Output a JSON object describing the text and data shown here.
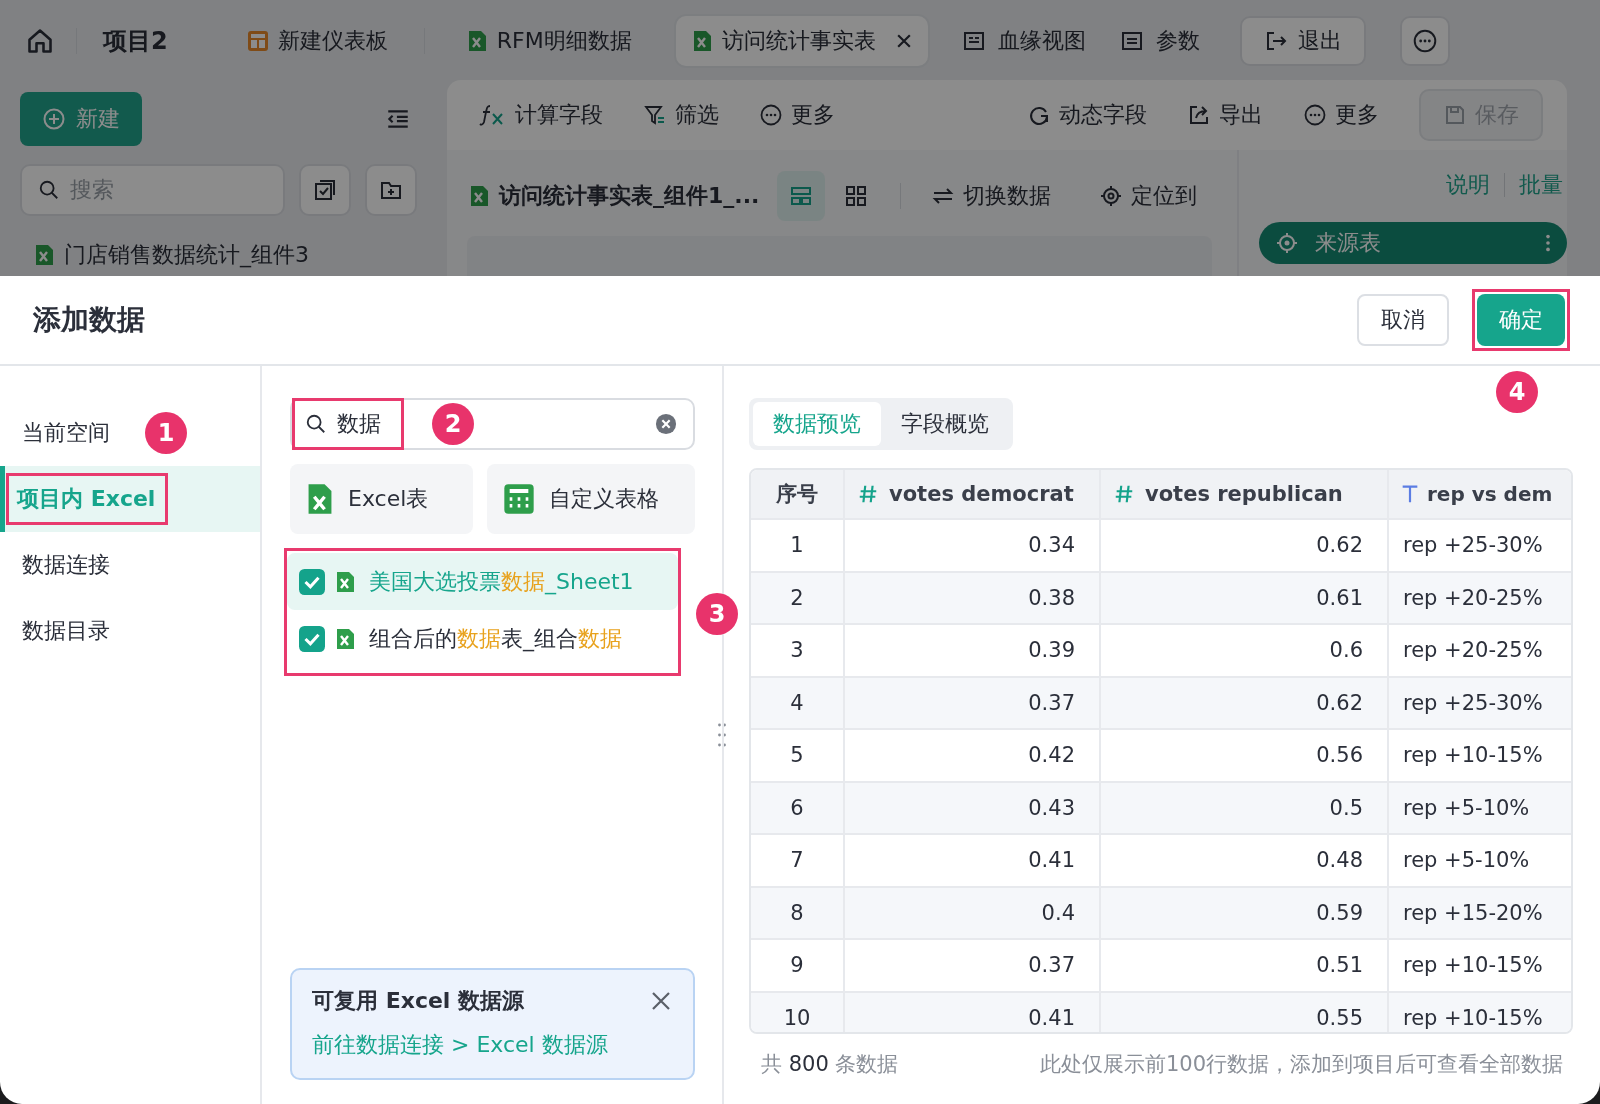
{
  "app": {
    "project": "项目2",
    "tabs": [
      {
        "label": "新建仪表板",
        "kind": "dashboard",
        "selected": false,
        "closable": false
      },
      {
        "label": "RFM明细数据",
        "kind": "excel",
        "selected": false,
        "closable": false
      },
      {
        "label": "访问统计事实表",
        "kind": "excel",
        "selected": true,
        "closable": true
      }
    ],
    "nav_links": [
      {
        "label": "血缘视图",
        "kind": "lineage"
      },
      {
        "label": "参数",
        "kind": "params"
      }
    ],
    "exit_button": "退出",
    "sidebar": {
      "new_button": "新建",
      "search_placeholder": "搜索",
      "tree": [
        {
          "label": "门店销售数据统计_组件3"
        }
      ]
    },
    "toolbar": {
      "left": [
        {
          "label": "计算字段",
          "kind": "fx"
        },
        {
          "label": "筛选",
          "kind": "filter"
        },
        {
          "label": "更多",
          "kind": "more"
        }
      ],
      "right": [
        {
          "label": "动态字段",
          "kind": "dynamic"
        },
        {
          "label": "导出",
          "kind": "export"
        },
        {
          "label": "更多",
          "kind": "more"
        }
      ],
      "save": {
        "label": "保存",
        "disabled": true
      }
    },
    "dataset": {
      "name": "访问统计事实表_组件1_...",
      "views": [
        {
          "kind": "table",
          "selected": true
        },
        {
          "kind": "grid",
          "selected": false
        }
      ],
      "actions": [
        {
          "label": "切换数据",
          "kind": "switch"
        },
        {
          "label": "定位到",
          "kind": "locate"
        }
      ]
    },
    "side_panel": {
      "links": [
        "说明",
        "批量"
      ],
      "source": "来源表"
    }
  },
  "dialog": {
    "title": "添加数据",
    "buttons": [
      {
        "label": "取消",
        "kind": "secondary",
        "highlighted": false
      },
      {
        "label": "确定",
        "kind": "primary",
        "highlighted": true,
        "badge": "4"
      }
    ],
    "nav": [
      {
        "label": "当前空间",
        "selected": false,
        "highlighted": false,
        "badge": "1"
      },
      {
        "label": "项目内 Excel",
        "selected": true,
        "highlighted": true
      },
      {
        "label": "数据连接",
        "selected": false,
        "highlighted": false
      },
      {
        "label": "数据目录",
        "selected": false,
        "highlighted": false
      }
    ],
    "search": {
      "value": "数据",
      "highlighted": true,
      "badge": "2"
    },
    "types": [
      {
        "label": "Excel表",
        "kind": "excel"
      },
      {
        "label": "自定义表格",
        "kind": "custom"
      }
    ],
    "results": {
      "highlighted": true,
      "badge": "3",
      "items": [
        {
          "parts": [
            {
              "text": "美国大选投票",
              "match": false
            },
            {
              "text": "数据",
              "match": true
            },
            {
              "text": "_Sheet1",
              "match": false
            }
          ],
          "checked": true,
          "active": true
        },
        {
          "parts": [
            {
              "text": "组合后的",
              "match": false
            },
            {
              "text": "数据",
              "match": true
            },
            {
              "text": "表_组合",
              "match": false
            },
            {
              "text": "数据",
              "match": true
            }
          ],
          "checked": true,
          "active": false
        }
      ]
    },
    "notice": {
      "title": "可复用 Excel 数据源",
      "link": "前往数据连接 > Excel 数据源"
    },
    "preview_tabs": [
      {
        "label": "数据预览",
        "selected": true
      },
      {
        "label": "字段概览",
        "selected": false
      }
    ],
    "table": {
      "columns": [
        {
          "label": "序号",
          "kind": "index"
        },
        {
          "label": "votes democrat",
          "kind": "number"
        },
        {
          "label": "votes republican",
          "kind": "number"
        },
        {
          "label": "rep vs dem",
          "kind": "text"
        }
      ],
      "rows": [
        [
          "1",
          "0.34",
          "0.62",
          "rep +25-30%"
        ],
        [
          "2",
          "0.38",
          "0.61",
          "rep +20-25%"
        ],
        [
          "3",
          "0.39",
          "0.6",
          "rep +20-25%"
        ],
        [
          "4",
          "0.37",
          "0.62",
          "rep +25-30%"
        ],
        [
          "5",
          "0.42",
          "0.56",
          "rep +10-15%"
        ],
        [
          "6",
          "0.43",
          "0.5",
          "rep +5-10%"
        ],
        [
          "7",
          "0.41",
          "0.48",
          "rep +5-10%"
        ],
        [
          "8",
          "0.4",
          "0.59",
          "rep +15-20%"
        ],
        [
          "9",
          "0.37",
          "0.51",
          "rep +10-15%"
        ],
        [
          "10",
          "0.41",
          "0.55",
          "rep +10-15%"
        ]
      ]
    },
    "footer": {
      "total": {
        "before": "共",
        "count": "800",
        "after": "条数据"
      },
      "note": "此处仅展示前100行数据，添加到项目后可查看全部数据"
    }
  }
}
